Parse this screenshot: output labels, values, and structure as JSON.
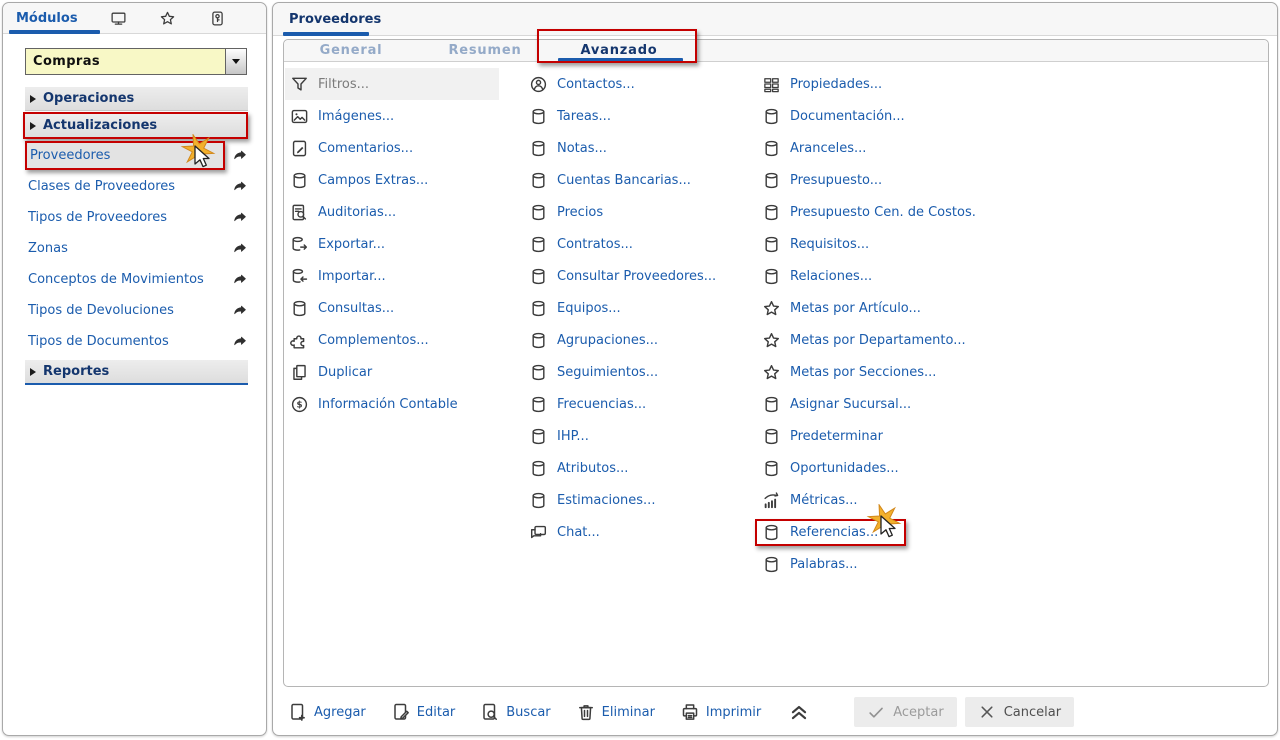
{
  "sidebar": {
    "tab_label": "Módulos",
    "header_icons": [
      "monitor-icon",
      "star-icon",
      "key-icon"
    ],
    "module_selector": {
      "value": "Compras"
    },
    "rows": [
      {
        "type": "section",
        "label": "Operaciones"
      },
      {
        "type": "section",
        "label": "Actualizaciones",
        "highlighted": true
      },
      {
        "type": "item",
        "label": "Proveedores",
        "highlighted": true,
        "cursor": true
      },
      {
        "type": "item",
        "label": "Clases de Proveedores"
      },
      {
        "type": "item",
        "label": "Tipos de Proveedores"
      },
      {
        "type": "item",
        "label": "Zonas"
      },
      {
        "type": "item",
        "label": "Conceptos de Movimientos"
      },
      {
        "type": "item",
        "label": "Tipos de Devoluciones"
      },
      {
        "type": "item",
        "label": "Tipos de Documentos"
      },
      {
        "type": "section",
        "label": "Reportes",
        "underlined": true
      }
    ]
  },
  "main": {
    "title": "Proveedores",
    "tabs": [
      {
        "label": "General"
      },
      {
        "label": "Resumen"
      },
      {
        "label": "Avanzado",
        "active": true,
        "highlighted": true
      }
    ],
    "columns": [
      {
        "items": [
          {
            "icon": "funnel-icon",
            "label": "Filtros...",
            "disabled": true
          },
          {
            "icon": "image-icon",
            "label": "Imágenes..."
          },
          {
            "icon": "clipboard-pencil-icon",
            "label": "Comentarios..."
          },
          {
            "icon": "database-icon",
            "label": "Campos Extras..."
          },
          {
            "icon": "audit-icon",
            "label": "Auditorias..."
          },
          {
            "icon": "database-export-icon",
            "label": "Exportar..."
          },
          {
            "icon": "database-import-icon",
            "label": "Importar..."
          },
          {
            "icon": "database-icon",
            "label": "Consultas..."
          },
          {
            "icon": "puzzle-icon",
            "label": "Complementos..."
          },
          {
            "icon": "copy-icon",
            "label": "Duplicar"
          },
          {
            "icon": "dollar-circle-icon",
            "label": "Información Contable"
          }
        ]
      },
      {
        "items": [
          {
            "icon": "contact-icon",
            "label": "Contactos..."
          },
          {
            "icon": "database-icon",
            "label": "Tareas..."
          },
          {
            "icon": "database-icon",
            "label": "Notas..."
          },
          {
            "icon": "database-icon",
            "label": "Cuentas Bancarias..."
          },
          {
            "icon": "database-icon",
            "label": "Precios"
          },
          {
            "icon": "database-icon",
            "label": "Contratos..."
          },
          {
            "icon": "database-icon",
            "label": "Consultar Proveedores..."
          },
          {
            "icon": "database-icon",
            "label": "Equipos..."
          },
          {
            "icon": "database-icon",
            "label": "Agrupaciones..."
          },
          {
            "icon": "database-icon",
            "label": "Seguimientos..."
          },
          {
            "icon": "database-icon",
            "label": "Frecuencias..."
          },
          {
            "icon": "database-icon",
            "label": "IHP..."
          },
          {
            "icon": "database-icon",
            "label": "Atributos..."
          },
          {
            "icon": "database-icon",
            "label": "Estimaciones..."
          },
          {
            "icon": "chat-icon",
            "label": "Chat..."
          }
        ]
      },
      {
        "items": [
          {
            "icon": "grid-icon",
            "label": "Propiedades..."
          },
          {
            "icon": "database-icon",
            "label": "Documentación..."
          },
          {
            "icon": "database-icon",
            "label": "Aranceles..."
          },
          {
            "icon": "database-icon",
            "label": "Presupuesto..."
          },
          {
            "icon": "database-icon",
            "label": "Presupuesto Cen. de Costos."
          },
          {
            "icon": "database-icon",
            "label": "Requisitos..."
          },
          {
            "icon": "database-icon",
            "label": "Relaciones..."
          },
          {
            "icon": "star-outline-icon",
            "label": "Metas por Artículo..."
          },
          {
            "icon": "star-outline-icon",
            "label": "Metas por Departamento..."
          },
          {
            "icon": "star-outline-icon",
            "label": "Metas por Secciones..."
          },
          {
            "icon": "database-icon",
            "label": "Asignar Sucursal..."
          },
          {
            "icon": "database-icon",
            "label": "Predeterminar"
          },
          {
            "icon": "database-icon",
            "label": "Oportunidades..."
          },
          {
            "icon": "metrics-icon",
            "label": "Métricas..."
          },
          {
            "icon": "database-icon",
            "label": "Referencias...",
            "highlighted": true,
            "cursor": true
          },
          {
            "icon": "database-icon",
            "label": "Palabras..."
          }
        ]
      }
    ],
    "toolbar": {
      "actions": [
        {
          "icon": "add-page-icon",
          "label": "Agregar"
        },
        {
          "icon": "edit-page-icon",
          "label": "Editar"
        },
        {
          "icon": "search-page-icon",
          "label": "Buscar"
        },
        {
          "icon": "trash-icon",
          "label": "Eliminar"
        },
        {
          "icon": "printer-icon",
          "label": "Imprimir"
        }
      ],
      "collapse_icon": "chevrons-up-icon",
      "buttons": [
        {
          "icon": "check-icon",
          "label": "Aceptar",
          "muted": true
        },
        {
          "icon": "x-icon",
          "label": "Cancelar"
        }
      ]
    }
  },
  "colors": {
    "link_blue": "#1b5cad",
    "title_navy": "#14366e",
    "inactive_tab": "#94aac8",
    "highlight_red": "#c40000",
    "module_bg_yellow": "#f8f8c6",
    "section_bar_gray": "#e4e4e4",
    "starburst_yellow": "#f2b02c"
  }
}
